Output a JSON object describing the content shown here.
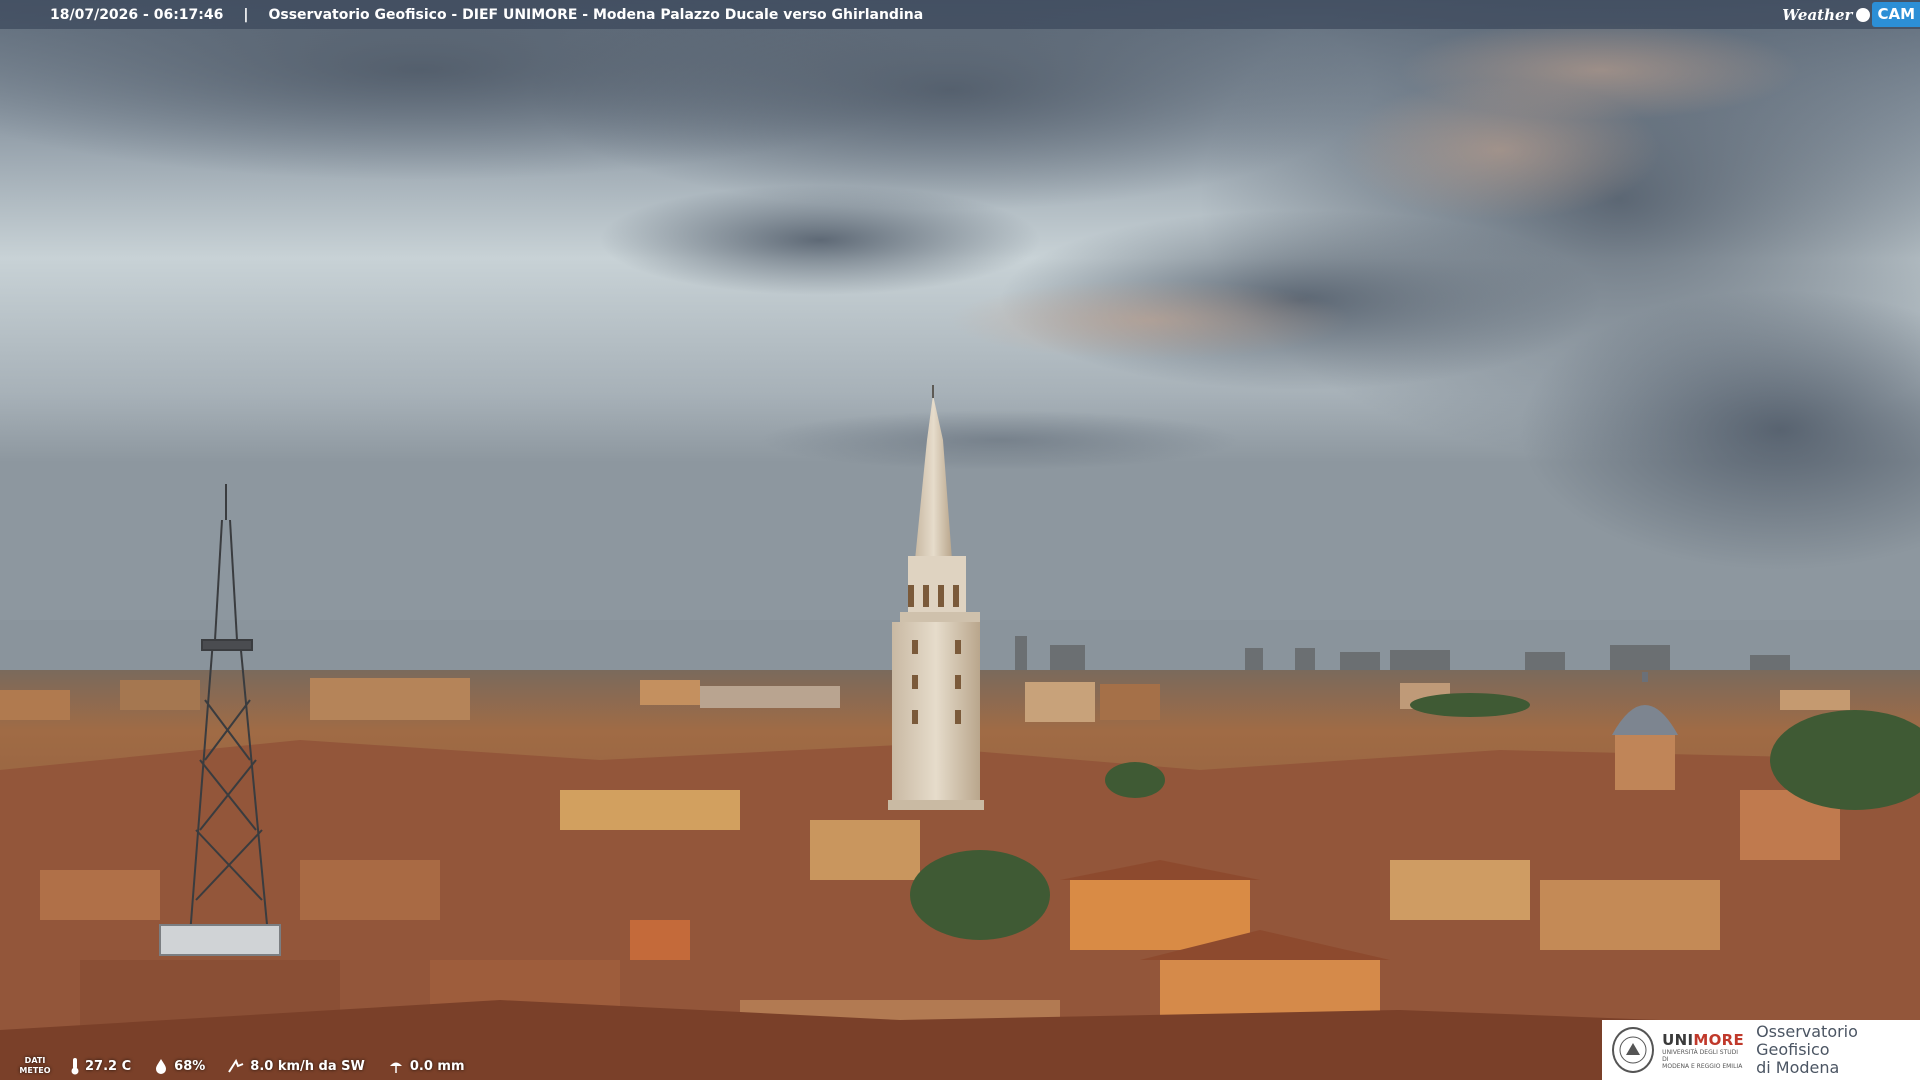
{
  "header": {
    "timestamp": "18/07/2026 - 06:17:46",
    "separator": "|",
    "title": "Osservatorio Geofisico - DIEF UNIMORE - Modena Palazzo Ducale verso Ghirlandina",
    "logo_weather": "Weather",
    "logo_cam": "CAM"
  },
  "weather": {
    "label_line1": "DATI",
    "label_line2": "METEO",
    "temperature": "27.2 C",
    "humidity": "68%",
    "wind": "8.0 km/h da SW",
    "rain": "0.0 mm",
    "icons": [
      "thermometer-icon",
      "humidity-drop-icon",
      "wind-icon",
      "rain-icon"
    ]
  },
  "sponsor": {
    "university_prefix": "UNI",
    "university_suffix": "MORE",
    "university_subtitle_1": "UNIVERSITÀ DEGLI STUDI DI",
    "university_subtitle_2": "MODENA E REGGIO EMILIA",
    "observatory_line1": "Osservatorio Geofisico",
    "observatory_line2": "di Modena"
  },
  "colors": {
    "sky_top": "#6f7f90",
    "sky_mid": "#c5d0d6",
    "haze": "#8e9aa4",
    "roofs": "#9a5a3a",
    "walls": "#c98c55",
    "tower": "#d8cbb8",
    "brand_blue": "#2c8fd6",
    "brand_red": "#c0392b"
  }
}
